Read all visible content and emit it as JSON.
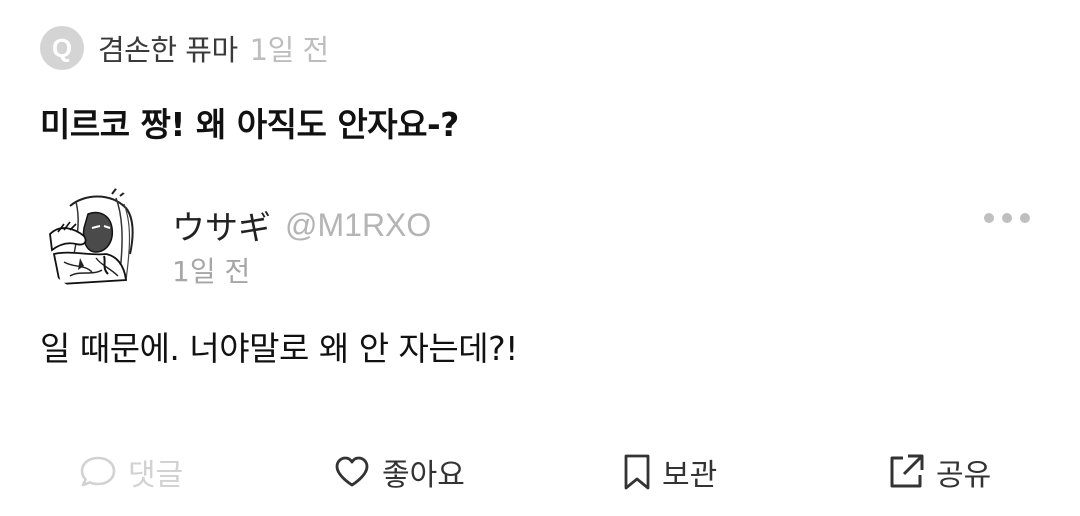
{
  "question": {
    "badge": "Q",
    "asker_name": "겸손한 퓨마",
    "time": "1일 전",
    "text": "미르코 짱! 왜 아직도 안자요-?"
  },
  "answer": {
    "name": "ウサギ",
    "handle": "@M1RXO",
    "time": "1일 전",
    "text": "일 때문에. 너야말로 왜 안 자는데?!"
  },
  "actions": {
    "comment": {
      "label": "댓글",
      "icon": "comment-icon",
      "enabled": false
    },
    "like": {
      "label": "좋아요",
      "icon": "heart-icon"
    },
    "save": {
      "label": "보관",
      "icon": "bookmark-icon"
    },
    "share": {
      "label": "공유",
      "icon": "share-icon"
    }
  },
  "colors": {
    "badge": "#d4d4d4",
    "muted_text": "#bdbdbd",
    "icon_dark": "#333333",
    "icon_disabled": "#d2d2d2"
  }
}
